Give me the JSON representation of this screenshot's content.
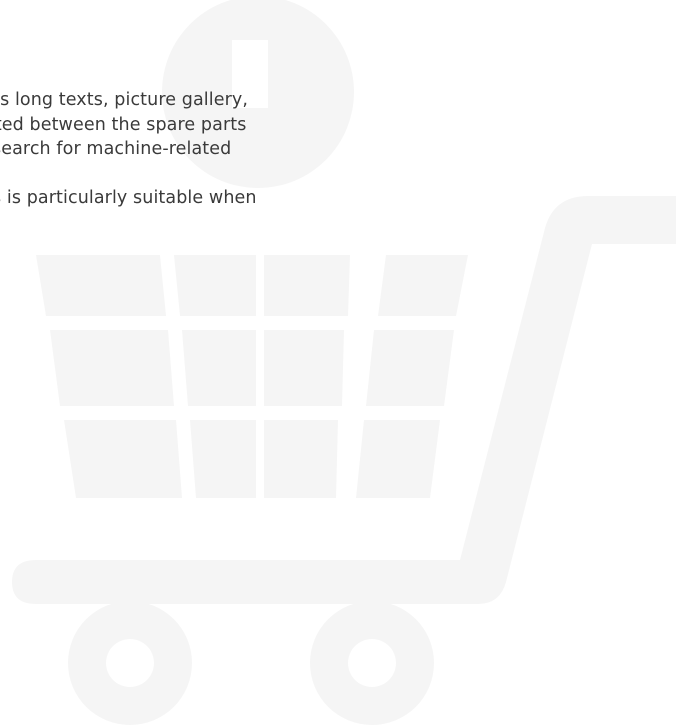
{
  "content": {
    "paragraphs": [
      {
        "lines": [
          "des long texts, picture gallery,",
          "ated between the spare parts",
          " search for machine-related"
        ]
      },
      {
        "lines": [
          "s is particularly suitable when"
        ]
      }
    ]
  },
  "background": {
    "icon": "shopping-cart-icon",
    "color": "#f5f5f5"
  }
}
